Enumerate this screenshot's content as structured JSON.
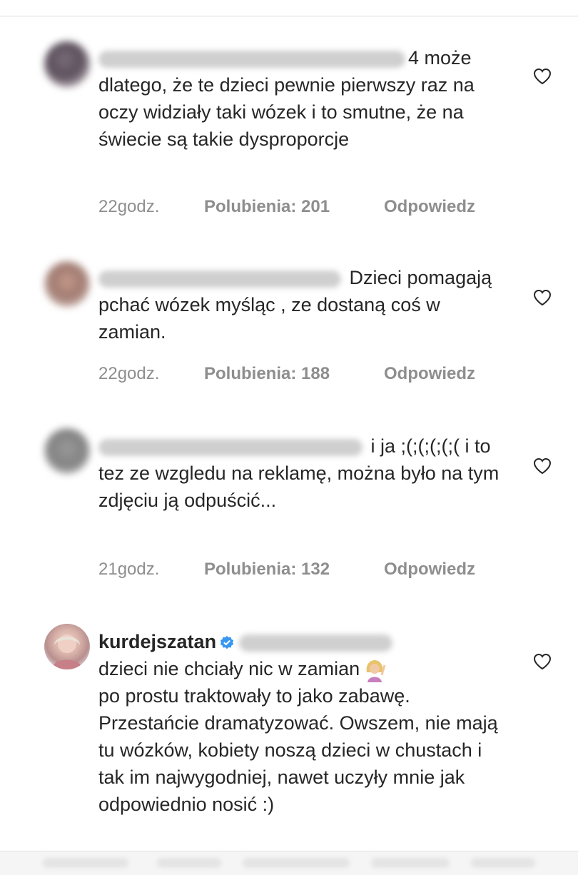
{
  "comments": [
    {
      "text": "może dlatego, że te dzieci pewnie pierwszy raz na oczy widziały taki wózek i to smutne, że na świecie są takie dysproporcje",
      "visible_prefix": "4",
      "time": "22godz.",
      "likes": "Polubienia: 201",
      "reply": "Odpowiedz"
    },
    {
      "text": "Dzieci pomagają pchać wózek myśląc , ze dostaną coś w zamian.",
      "time": "22godz.",
      "likes": "Polubienia: 188",
      "reply": "Odpowiedz"
    },
    {
      "text": "i ja ;(;(;(;(;( i to tez ze wzgledu na reklamę, można było na tym zdjęciu ją odpuścić...",
      "time": "21godz.",
      "likes": "Polubienia: 132",
      "reply": "Odpowiedz"
    },
    {
      "username": "kurdejszatan",
      "text_line1": "dzieci nie chciały nic w zamian",
      "text_rest": "po prostu traktowały to jako zabawę. Przestańcie dramatyzować. Owszem, nie mają tu wózków, kobiety noszą dzieci w chustach i tak im najwygodniej, nawet uczyły mnie jak odpowiednio nosić :)",
      "emoji": "woman-raising-hand-emoji"
    }
  ],
  "colors": {
    "text": "#262626",
    "meta": "#8e8e8e",
    "verified": "#3897f0",
    "heart_stroke": "#262626"
  }
}
